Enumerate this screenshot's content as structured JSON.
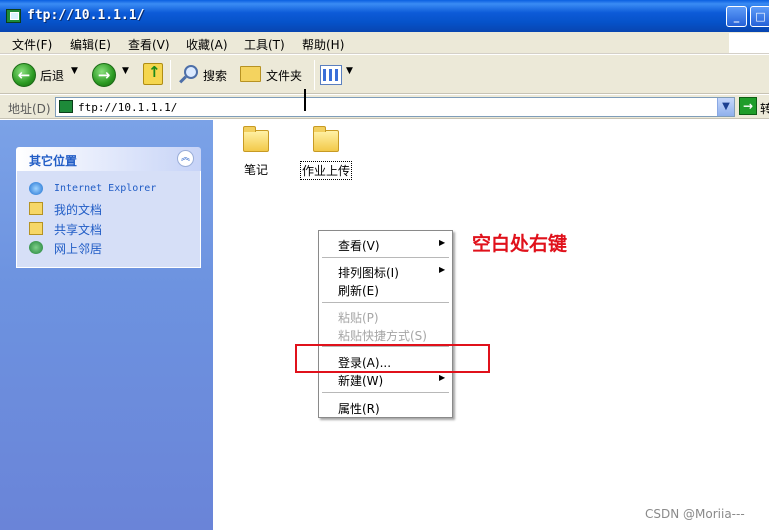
{
  "window": {
    "title": "ftp://10.1.1.1/",
    "minimize_glyph": "_",
    "maximize_glyph": "□"
  },
  "menubar": {
    "items": [
      "文件(F)",
      "编辑(E)",
      "查看(V)",
      "收藏(A)",
      "工具(T)",
      "帮助(H)"
    ]
  },
  "toolbar": {
    "back_label": "后退",
    "search_label": "搜索",
    "folders_label": "文件夹",
    "icons": [
      "back-arrow-icon",
      "forward-arrow-icon",
      "up-folder-icon",
      "search-icon",
      "folders-icon",
      "views-icon"
    ]
  },
  "address": {
    "label": "地址(D)",
    "value": "ftp://10.1.1.1/",
    "go_label": "转"
  },
  "taskpane": {
    "section_title": "其它位置",
    "items": [
      {
        "label": "Internet Explorer",
        "icon": "ie-icon"
      },
      {
        "label": "我的文档",
        "icon": "my-documents-icon"
      },
      {
        "label": "共享文档",
        "icon": "shared-documents-icon"
      },
      {
        "label": "网上邻居",
        "icon": "network-places-icon"
      }
    ]
  },
  "content": {
    "folders": [
      {
        "label": "笔记",
        "icon": "folder-icon"
      },
      {
        "label": "作业上传",
        "icon": "folder-icon",
        "selected": true
      }
    ]
  },
  "context_menu": {
    "items": [
      {
        "label": "查看(V)",
        "submenu": true,
        "enabled": true
      },
      {
        "label": "排列图标(I)",
        "submenu": true,
        "enabled": true
      },
      {
        "label": "刷新(E)",
        "submenu": false,
        "enabled": true
      },
      {
        "label": "粘贴(P)",
        "submenu": false,
        "enabled": false
      },
      {
        "label": "粘贴快捷方式(S)",
        "submenu": false,
        "enabled": false
      },
      {
        "label": "登录(A)...",
        "submenu": false,
        "enabled": true,
        "highlighted": true
      },
      {
        "label": "新建(W)",
        "submenu": true,
        "enabled": true
      },
      {
        "label": "属性(R)",
        "submenu": false,
        "enabled": true
      }
    ],
    "submenu_glyph": "▶"
  },
  "annotation": {
    "text": "空白处右键",
    "color": "#e0111b"
  },
  "watermark": "CSDN @Moriia---",
  "colors": {
    "titlebar": "#0652c9",
    "taskpane": "#6d93e0",
    "link": "#215dc6",
    "highlight_box": "#e0111b"
  }
}
